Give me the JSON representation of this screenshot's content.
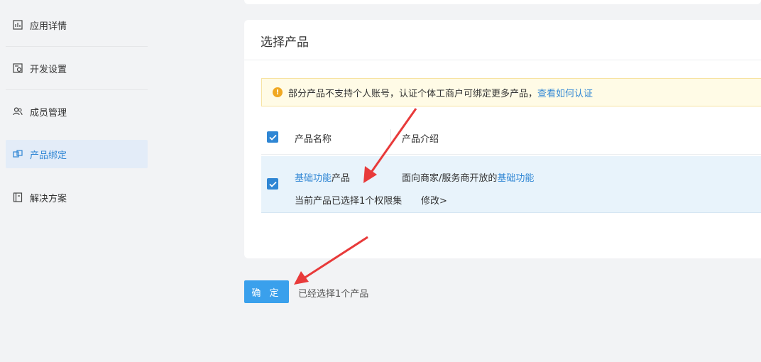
{
  "sidebar": {
    "items": [
      {
        "label": "应用详情",
        "icon": "chart-icon"
      },
      {
        "label": "开发设置",
        "icon": "settings-doc-icon"
      },
      {
        "label": "成员管理",
        "icon": "users-icon"
      },
      {
        "label": "产品绑定",
        "icon": "link-icon",
        "active": true
      },
      {
        "label": "解决方案",
        "icon": "book-icon"
      }
    ]
  },
  "card": {
    "title": "选择产品",
    "notice": {
      "text": "部分产品不支持个人账号，认证个体工商户可绑定更多产品，",
      "link": "查看如何认证"
    },
    "table": {
      "headers": [
        "产品名称",
        "产品介绍"
      ],
      "row": {
        "name_link": "基础功能",
        "name_suffix": "产品",
        "intro_prefix": "面向商家/服务商开放的",
        "intro_link": "基础功能",
        "status_text": "当前产品已选择1个权限集",
        "modify_link": "修改>"
      }
    }
  },
  "footer": {
    "confirm_label": "确 定",
    "selected_text": "已经选择1个产品"
  },
  "colors": {
    "accent": "#2f86d4",
    "button": "#3aa0ec",
    "notice_bg": "#fffbe6",
    "row_selected_bg": "#e8f3fb",
    "annotation_arrow": "#e83a3a"
  }
}
